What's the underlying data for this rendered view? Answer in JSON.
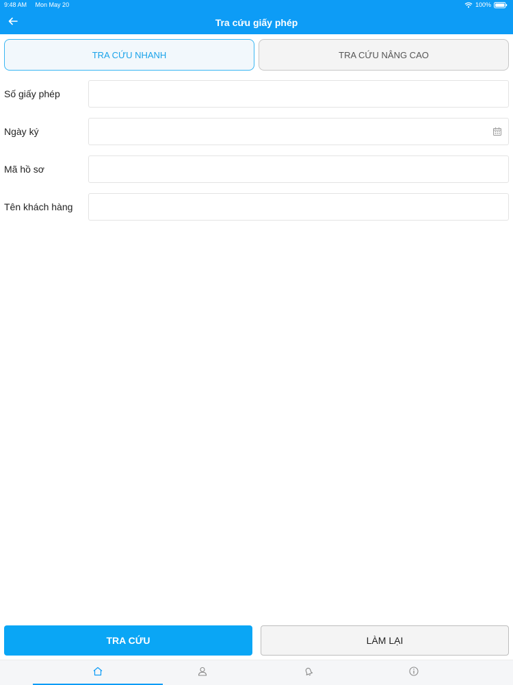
{
  "status_bar": {
    "time": "9:48 AM",
    "date": "Mon May 20",
    "battery": "100%"
  },
  "nav": {
    "title": "Tra cứu giấy phép",
    "back_icon": "arrow-left-icon"
  },
  "tabs": [
    {
      "label": "TRA CỨU NHANH",
      "active": true
    },
    {
      "label": "TRA CỨU NÂNG CAO",
      "active": false
    }
  ],
  "form": {
    "fields": [
      {
        "label": "Số giấy phép",
        "value": "",
        "placeholder": ""
      },
      {
        "label": "Ngày ký",
        "value": "",
        "placeholder": "",
        "icon": "calendar-icon"
      },
      {
        "label": "Mã hồ sơ",
        "value": "",
        "placeholder": ""
      },
      {
        "label": "Tên khách hàng",
        "value": "",
        "placeholder": ""
      }
    ]
  },
  "actions": {
    "search_label": "TRA CỨU",
    "reset_label": "LÀM LẠI"
  },
  "tabbar": {
    "items": [
      {
        "icon": "home-icon",
        "active": true
      },
      {
        "icon": "user-icon",
        "active": false
      },
      {
        "icon": "bell-icon",
        "active": false
      },
      {
        "icon": "info-icon",
        "active": false
      }
    ]
  },
  "colors": {
    "primary": "#0d9cf6",
    "tab_active_text": "#1aa3ea",
    "tab_active_border": "#38b6f3"
  }
}
